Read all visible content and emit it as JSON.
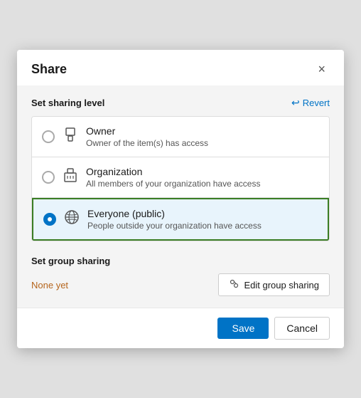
{
  "dialog": {
    "title": "Share",
    "close_label": "×"
  },
  "sharing_level": {
    "section_label": "Set sharing level",
    "revert_label": "Revert",
    "options": [
      {
        "id": "owner",
        "name": "Owner",
        "description": "Owner of the item(s) has access",
        "selected": false,
        "icon": "owner-icon"
      },
      {
        "id": "organization",
        "name": "Organization",
        "description": "All members of your organization have access",
        "selected": false,
        "icon": "organization-icon"
      },
      {
        "id": "everyone",
        "name": "Everyone (public)",
        "description": "People outside your organization have access",
        "selected": true,
        "icon": "public-icon"
      }
    ]
  },
  "group_sharing": {
    "section_label": "Set group sharing",
    "none_label": "None yet",
    "edit_button_label": "Edit group sharing"
  },
  "footer": {
    "save_label": "Save",
    "cancel_label": "Cancel"
  }
}
